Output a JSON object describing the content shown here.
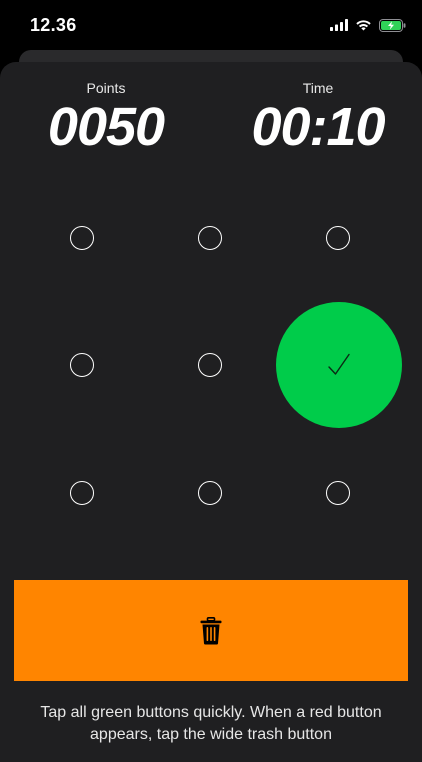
{
  "status_bar": {
    "time": "12.36",
    "icons": [
      "cellular-signal-icon",
      "wifi-icon",
      "battery-charging-icon"
    ],
    "battery_color": "#30d158"
  },
  "scoreboard": {
    "points_label": "Points",
    "points_value": "0050",
    "time_label": "Time",
    "time_value": "00:10"
  },
  "grid": {
    "rows": 3,
    "columns": 3,
    "active_cell": {
      "row": 2,
      "column": 3,
      "state": "green",
      "icon": "checkmark-icon"
    },
    "colors": {
      "target_green": "#00cc4a",
      "empty_ring": "#ffffff"
    }
  },
  "trash_button": {
    "icon": "trash-icon",
    "color": "#ff8500"
  },
  "instructions": {
    "text": "Tap all green buttons quickly. When a red button appears, tap the wide trash button"
  },
  "theme": {
    "background": "#000000",
    "panel": "#1f1f21"
  }
}
